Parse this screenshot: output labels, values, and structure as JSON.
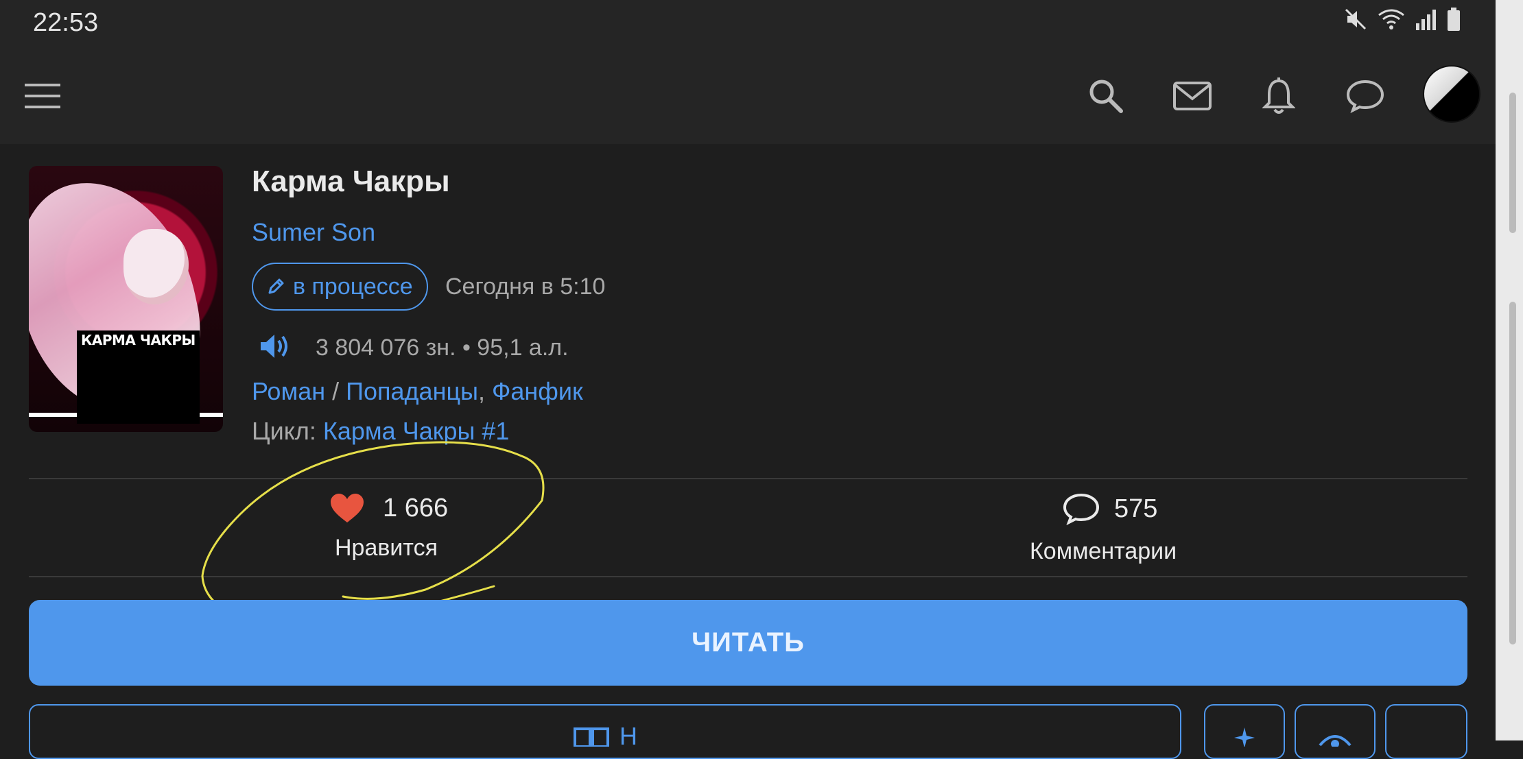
{
  "status_bar": {
    "time": "22:53"
  },
  "header": {
    "menu_icon": "hamburger-menu-icon",
    "icons": [
      "search-icon",
      "mail-icon",
      "bell-icon",
      "chat-bubble-icon"
    ]
  },
  "book": {
    "cover_title": "КАРМА ЧАКРЫ",
    "title": "Карма Чакры",
    "author": "Sumer Son",
    "status_label": "в процессе",
    "updated": "Сегодня в 5:10",
    "size": "3 804 076 зн. • 95,1 а.л.",
    "genre_main": "Роман",
    "genre_sep": " / ",
    "genre_1": "Попаданцы",
    "genre_comma": ", ",
    "genre_2": "Фанфик",
    "cycle_label": "Цикл: ",
    "cycle_link": "Карма Чакры #1"
  },
  "stats": {
    "likes_count": "1 666",
    "likes_label": "Нравится",
    "comments_count": "575",
    "comments_label": "Комментарии"
  },
  "actions": {
    "read_label": "ЧИТАТЬ",
    "partial_label": "Н"
  },
  "colors": {
    "accent": "#4f97ec",
    "background": "#1e1e1e",
    "header": "#252525",
    "heart": "#e8553f",
    "highlight": "#e6df4a"
  }
}
